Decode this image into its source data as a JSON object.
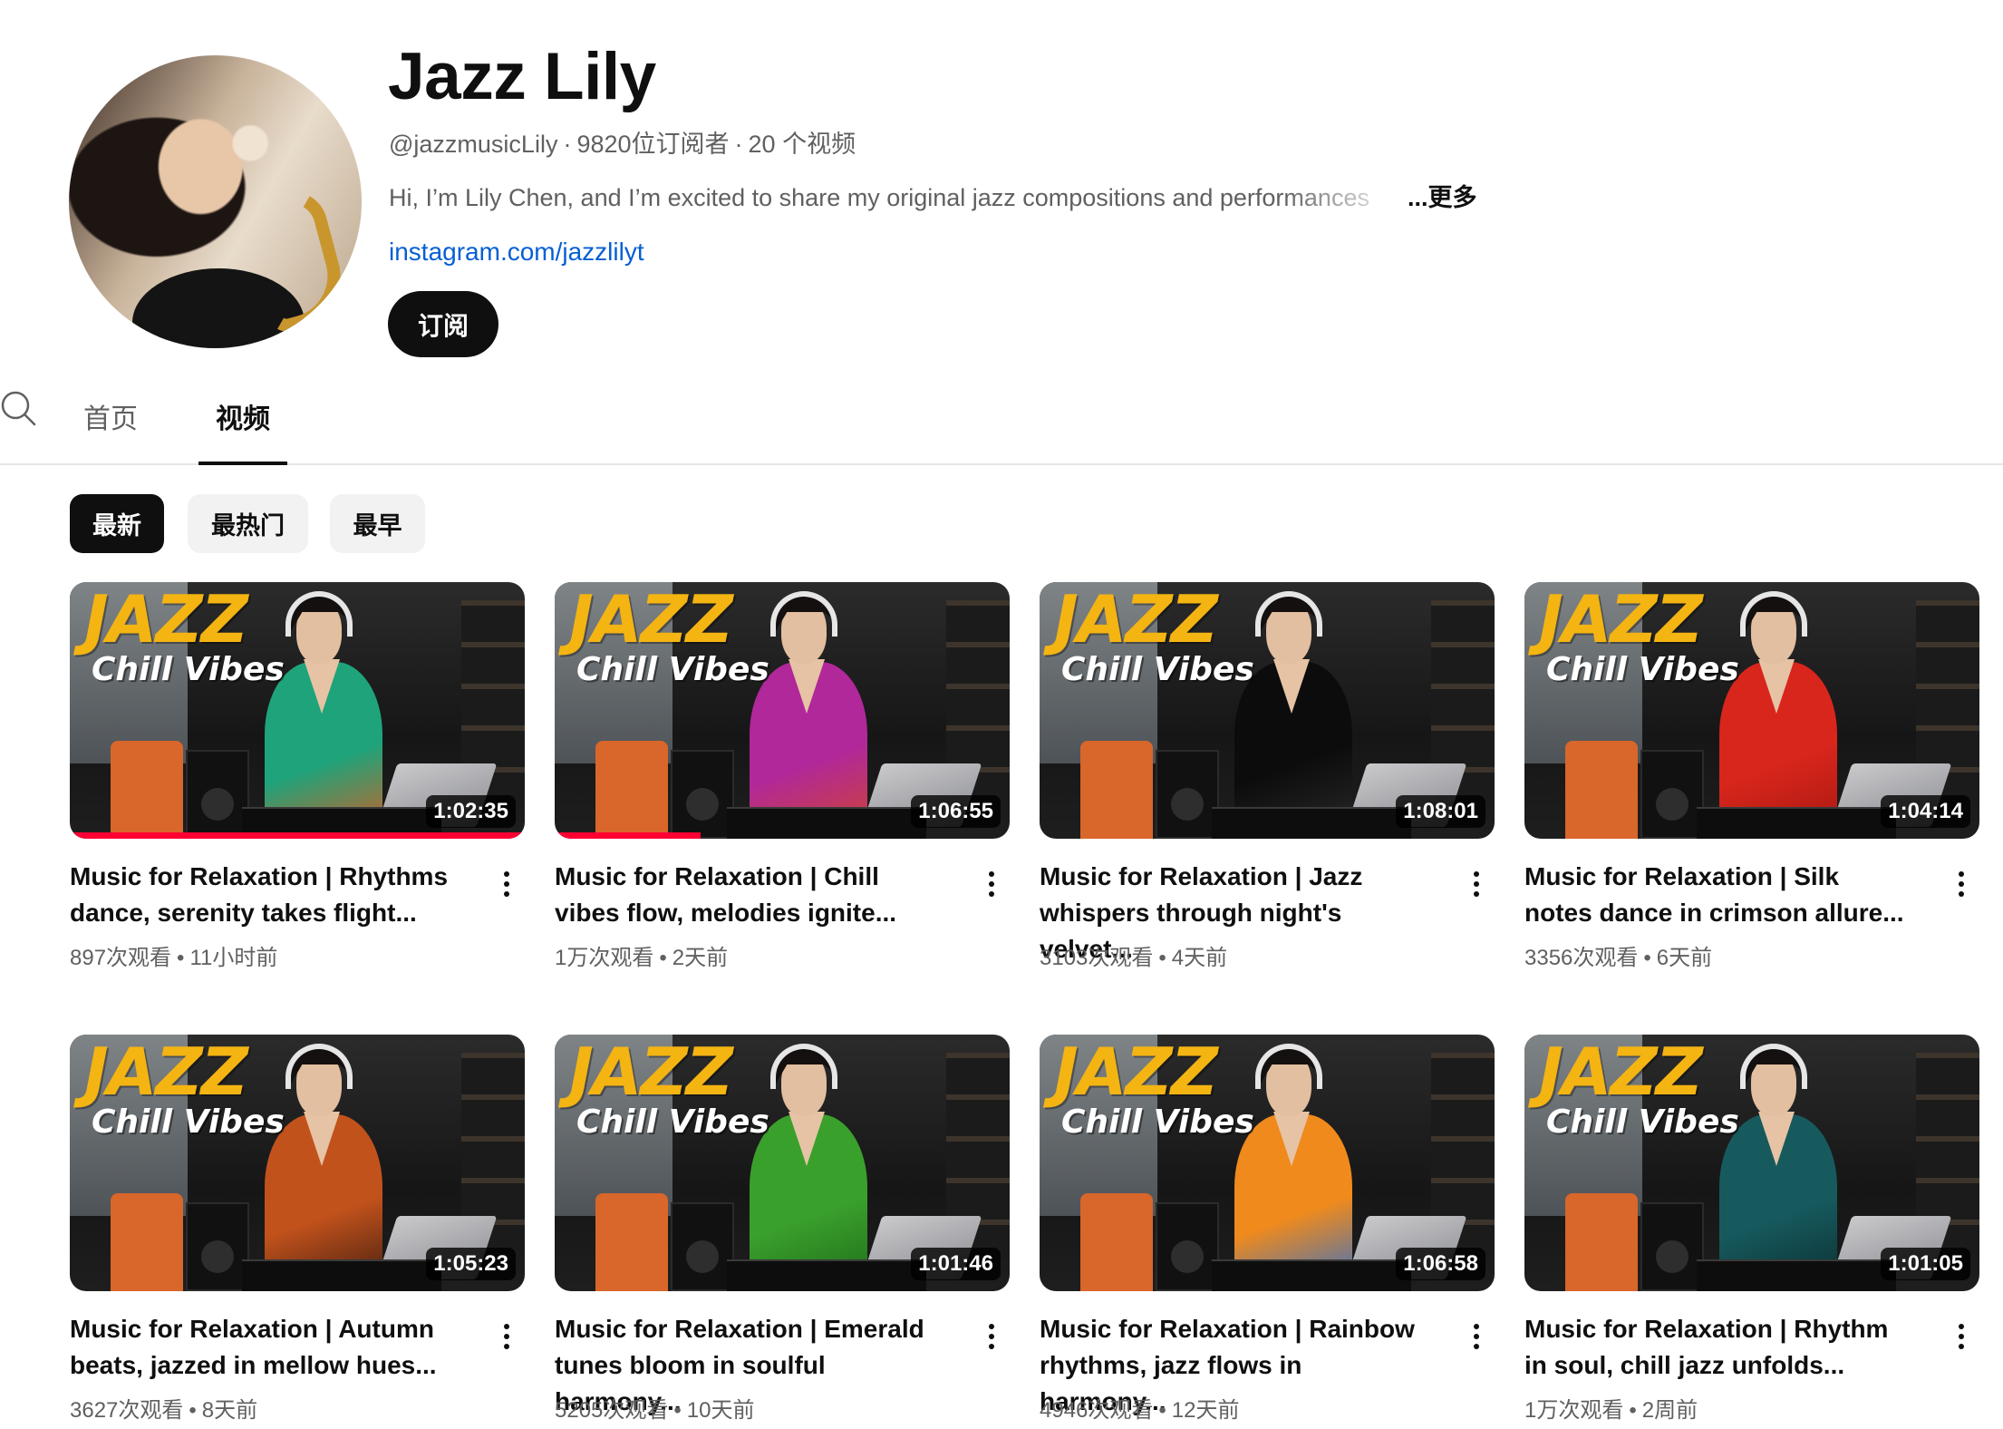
{
  "channel": {
    "name": "Jazz Lily",
    "handle": "@jazzmusicLily",
    "subscribers": "9820位订阅者",
    "video_count": "20 个视频",
    "description": "Hi, I’m Lily Chen, and I’m excited to share my original jazz compositions and performances",
    "more_label": "...更多",
    "link": "instagram.com/jazzlilyt",
    "subscribe_label": "订阅"
  },
  "tabs": [
    {
      "label": "首页",
      "active": false
    },
    {
      "label": "视频",
      "active": true
    }
  ],
  "chips": [
    {
      "label": "最新",
      "active": true
    },
    {
      "label": "最热门",
      "active": false
    },
    {
      "label": "最早",
      "active": false
    }
  ],
  "thumbnail_text": {
    "line1": "JAZZ",
    "line2": "Chill Vibes"
  },
  "videos": [
    {
      "title": "Music for Relaxation | Rhythms dance, serenity takes flight...",
      "duration": "1:02:35",
      "views": "897次观看",
      "age": "11小时前",
      "dress_color": "#1fa37a",
      "dress_color2": "#e05a1e",
      "watched_fraction": 1.0
    },
    {
      "title": "Music for Relaxation | Chill vibes flow, melodies ignite...",
      "duration": "1:06:55",
      "views": "1万次观看",
      "age": "2天前",
      "dress_color": "#b0289a",
      "dress_color2": "#d2452a",
      "watched_fraction": 0.32
    },
    {
      "title": "Music for Relaxation | Jazz whispers through night's velvet...",
      "duration": "1:08:01",
      "views": "3103次观看",
      "age": "4天前",
      "dress_color": "#0c0c0c",
      "dress_color2": "#2a2a2a",
      "watched_fraction": 0
    },
    {
      "title": "Music for Relaxation | Silk notes dance in crimson allure...",
      "duration": "1:04:14",
      "views": "3356次观看",
      "age": "6天前",
      "dress_color": "#d8261c",
      "dress_color2": "#a51710",
      "watched_fraction": 0
    },
    {
      "title": "Music for Relaxation | Autumn beats, jazzed in mellow hues...",
      "duration": "1:05:23",
      "views": "3627次观看",
      "age": "8天前",
      "dress_color": "#c2521c",
      "dress_color2": "#3a1a0e",
      "watched_fraction": 0
    },
    {
      "title": "Music for Relaxation | Emerald tunes bloom in soulful harmony...",
      "duration": "1:01:46",
      "views": "5205次观看",
      "age": "10天前",
      "dress_color": "#3aa02c",
      "dress_color2": "#1d6a18",
      "watched_fraction": 0
    },
    {
      "title": "Music for Relaxation | Rainbow rhythms, jazz flows in harmony...",
      "duration": "1:06:58",
      "views": "4946次观看",
      "age": "12天前",
      "dress_color": "#f08a1c",
      "dress_color2": "#2a6fd0",
      "watched_fraction": 0
    },
    {
      "title": "Music for Relaxation | Rhythm in soul, chill jazz unfolds...",
      "duration": "1:01:05",
      "views": "1万次观看",
      "age": "2周前",
      "dress_color": "#165a5e",
      "dress_color2": "#0b2d2f",
      "watched_fraction": 0
    }
  ],
  "colors": {
    "accent_link": "#065fd4",
    "progress": "#ff0033",
    "jazz_text": "#f4b412"
  },
  "icons": {
    "search": "search-icon",
    "more": "more-vert-icon"
  }
}
